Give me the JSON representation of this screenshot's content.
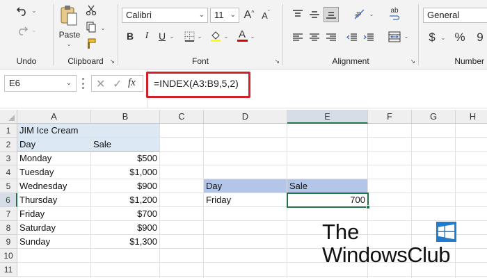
{
  "ribbon": {
    "undo_group": "Undo",
    "clipboard_group": "Clipboard",
    "paste_label": "Paste",
    "font_group": "Font",
    "font_name": "Calibri",
    "font_size": "11",
    "alignment_group": "Alignment",
    "number_group": "Number",
    "number_format": "General",
    "currency_symbol": "$",
    "percent_symbol": "%",
    "comma_symbol": "9",
    "bold": "B",
    "italic": "I",
    "underline": "U",
    "font_color_letter": "A",
    "grow_font": "A",
    "shrink_font": "A",
    "wrap_label": "ab"
  },
  "formula_bar": {
    "name_box": "E6",
    "cancel_symbol": "✕",
    "enter_symbol": "✓",
    "fx_symbol": "fx",
    "formula": "=INDEX(A3:B9,5,2)"
  },
  "sheet": {
    "columns": [
      "A",
      "B",
      "C",
      "D",
      "E",
      "F",
      "G",
      "H"
    ],
    "rows": [
      "1",
      "2",
      "3",
      "4",
      "5",
      "6",
      "7",
      "8",
      "9",
      "10",
      "11"
    ],
    "selected_column": "E",
    "selected_row": "6",
    "title": "JIM Ice Cream",
    "table_headers": {
      "day": "Day",
      "sale": "Sale"
    },
    "table_rows": [
      {
        "day": "Monday",
        "sale": "$500"
      },
      {
        "day": "Tuesday",
        "sale": "$1,000"
      },
      {
        "day": "Wednesday",
        "sale": "$900"
      },
      {
        "day": "Thursday",
        "sale": "$1,200"
      },
      {
        "day": "Friday",
        "sale": "$700"
      },
      {
        "day": "Saturday",
        "sale": "$900"
      },
      {
        "day": "Sunday",
        "sale": "$1,300"
      }
    ],
    "lookup_headers": {
      "day": "Day",
      "sale": "Sale"
    },
    "lookup_day": "Friday",
    "lookup_result": "700"
  },
  "watermark": {
    "line1": "The",
    "line2": "WindowsClub"
  },
  "colors": {
    "excel_green": "#217346",
    "highlight_red": "#d0202a",
    "table_blue": "#dde8f5",
    "header_blue": "#b4c6e7"
  }
}
